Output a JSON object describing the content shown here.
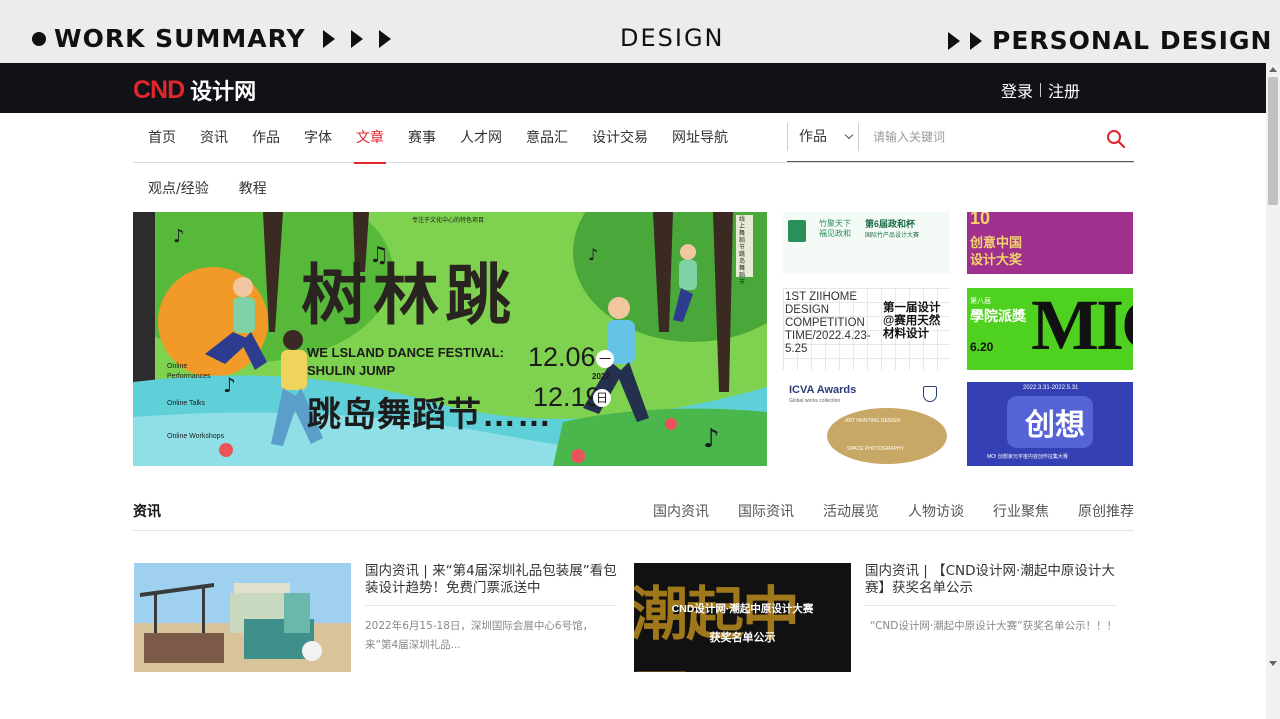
{
  "banner": {
    "left": "WORK SUMMARY",
    "center": "DESIGN",
    "right": "PERSONAL DESIGN",
    "icons": [
      "bullet-dot-icon",
      "play-triangle-icon"
    ]
  },
  "header": {
    "logo_mark": "CND",
    "logo_text": "设计网",
    "login": "登录",
    "register": "注册"
  },
  "nav": {
    "items": [
      {
        "label": "首页"
      },
      {
        "label": "资讯"
      },
      {
        "label": "作品"
      },
      {
        "label": "字体"
      },
      {
        "label": "文章",
        "active": true
      },
      {
        "label": "赛事"
      },
      {
        "label": "人才网"
      },
      {
        "label": "意品汇"
      },
      {
        "label": "设计交易"
      },
      {
        "label": "网址导航"
      }
    ]
  },
  "search": {
    "category": "作品",
    "placeholder": "请输入关键词"
  },
  "subnav": {
    "items": [
      {
        "label": "观点/经验"
      },
      {
        "label": "教程"
      }
    ]
  },
  "hero": {
    "side_label": "线上舞蹈节 跳岛舞蹈节",
    "top_caption": "专注于文化中心的特色项目",
    "title_cn_big": "树林跳",
    "festival_en": "WE LSLAND DANCE FESTIVAL:",
    "shulin": "SHULIN JUMP",
    "date1": "12.06",
    "date2": "12.19",
    "day1": "一",
    "day2": "日",
    "year": "2022",
    "title_cn": "跳岛舞蹈节……",
    "list": [
      "Online Performances",
      "Online Talks",
      "Online Workshops"
    ]
  },
  "thumbs": {
    "t1_line1": "竹聚天下",
    "t1_line2": "福见政和",
    "t1_title": "第6届政和杯",
    "t1_sub": "国际竹产品设计大赛",
    "t2_title": "创意中国",
    "t2_sub": "设计大奖",
    "t3_en": "1ST ZIIHOME DESIGN COMPETITION TIME/2022.4.23-5.25",
    "t3_cn": "第一届设计@赛用天然材料设计",
    "t4_num": "第八届",
    "t4_title": "學院派獎",
    "t4_date": "6.20",
    "t4_big": "MIC",
    "t5_title": "ICVA Awards",
    "t5_sub": "Global works collection",
    "t5_ring1": "ART PAINTING DESIGN",
    "t5_ring2": "SPACE PHOTOGRAPHY",
    "t6_date": "2022.3.31-2022.5.31",
    "t6_title": "创想",
    "t6_sub": "MO! 创想家元宇宙内容创作征集大赛"
  },
  "news": {
    "section_title": "资讯",
    "tabs": [
      {
        "label": "国内资讯"
      },
      {
        "label": "国际资讯"
      },
      {
        "label": "活动展览"
      },
      {
        "label": "人物访谈"
      },
      {
        "label": "行业聚焦"
      },
      {
        "label": "原创推荐"
      }
    ],
    "items": [
      {
        "title": "国内资讯 | 来“第4届深圳礼品包装展”看包装设计趋势！免费门票派送中",
        "desc": "2022年6月15-18日，深圳国际会展中心6号馆，来“第4届深圳礼品..."
      },
      {
        "title": "国内资讯 | 【CND设计网·潮起中原设计大赛】获奖名单公示",
        "desc": "“CND设计网·潮起中原设计大赛”获奖名单公示！！！",
        "img_banner": "CND设计网·潮起中原设计大赛",
        "img_sub": "获奖名单公示",
        "img_big": "潮起中原"
      }
    ]
  },
  "colors": {
    "brand_red": "#e1262c",
    "topbar": "#111217",
    "hero_green": "#6ccb3e"
  }
}
